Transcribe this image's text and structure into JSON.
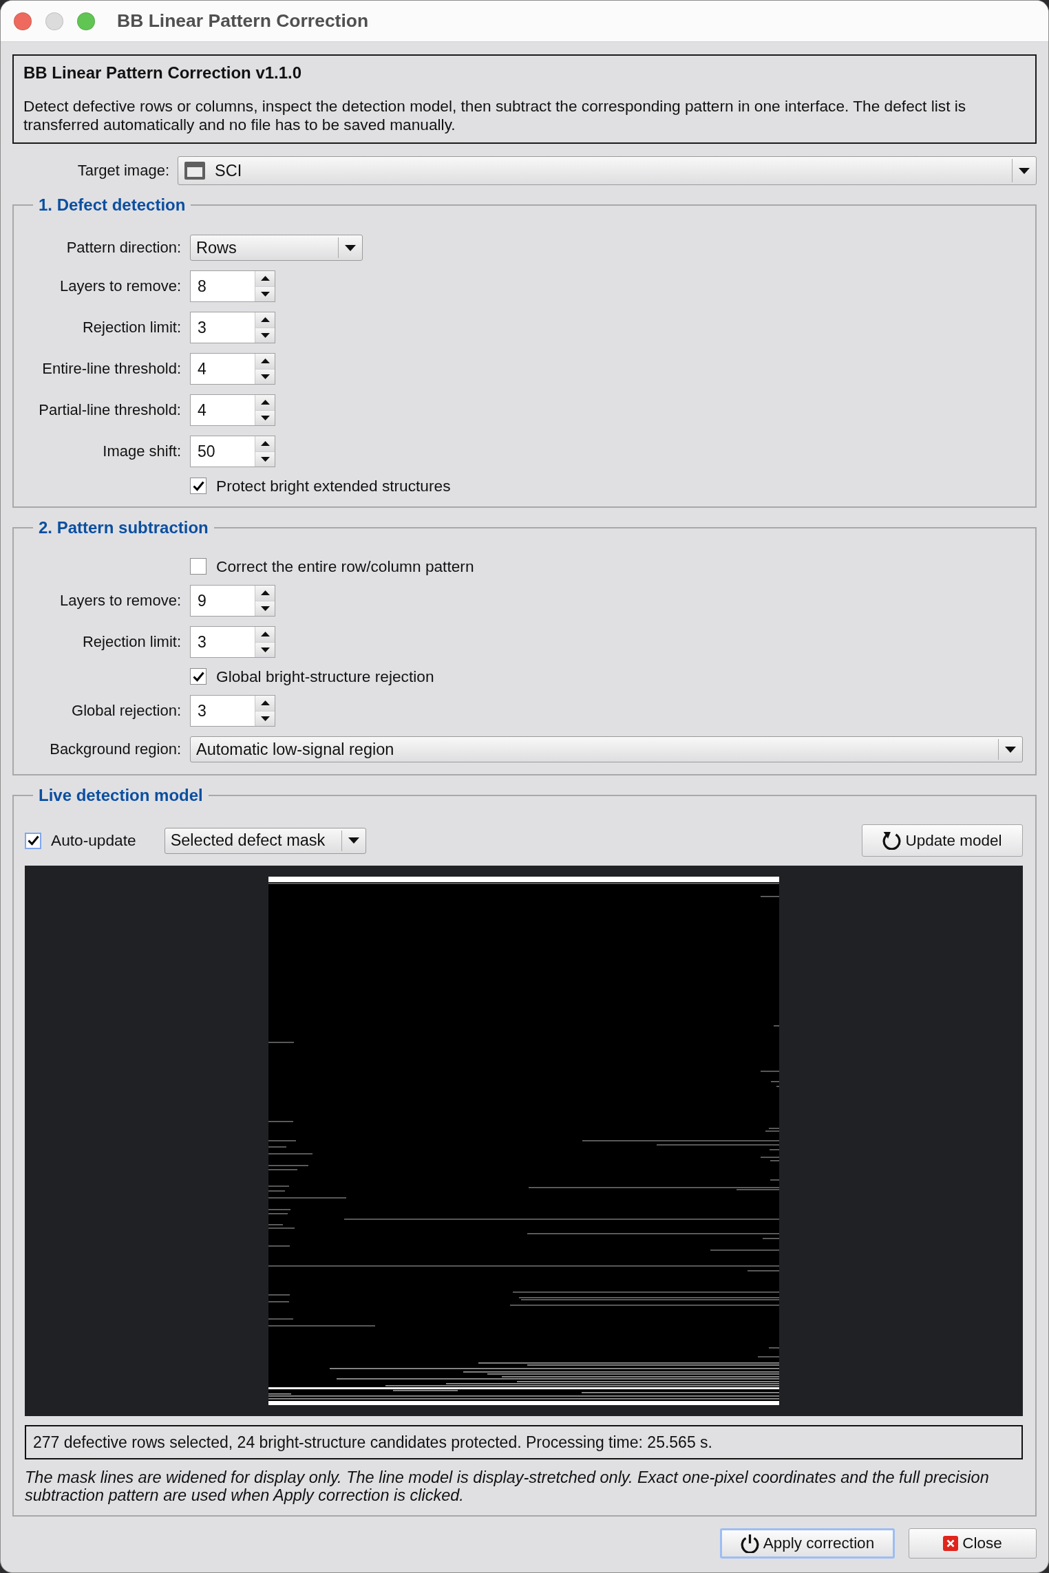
{
  "window": {
    "title": "BB Linear Pattern Correction",
    "controls": [
      {
        "kind": "close",
        "disabled": false
      },
      {
        "kind": "minimize",
        "disabled": true
      },
      {
        "kind": "zoom",
        "disabled": false
      }
    ]
  },
  "header": {
    "title": "BB Linear Pattern Correction v1.1.0",
    "description": "Detect defective rows or columns, inspect the detection model, then subtract the corresponding pattern in one interface. The defect list is transferred automatically and no file has to be saved manually."
  },
  "target_image": {
    "label": "Target image:",
    "value": "SCI"
  },
  "defect_detection": {
    "title": "1. Defect detection",
    "fields": [
      {
        "kind": "combo",
        "label": "Pattern direction:",
        "value": "Rows"
      },
      {
        "kind": "spin",
        "label": "Layers to remove:",
        "value": "8"
      },
      {
        "kind": "spin",
        "label": "Rejection limit:",
        "value": "3"
      },
      {
        "kind": "spin",
        "label": "Entire-line threshold:",
        "value": "4"
      },
      {
        "kind": "spin",
        "label": "Partial-line threshold:",
        "value": "4"
      },
      {
        "kind": "spin",
        "label": "Image shift:",
        "value": "50"
      },
      {
        "kind": "check",
        "label": "Protect bright extended structures",
        "checked": true
      }
    ]
  },
  "pattern_subtraction": {
    "title": "2. Pattern subtraction",
    "fields": [
      {
        "kind": "check",
        "label": "Correct the entire row/column pattern",
        "checked": false
      },
      {
        "kind": "spin",
        "label": "Layers to remove:",
        "value": "9"
      },
      {
        "kind": "spin",
        "label": "Rejection limit:",
        "value": "3"
      },
      {
        "kind": "check",
        "label": "Global bright-structure rejection",
        "checked": true
      },
      {
        "kind": "spin",
        "label": "Global rejection:",
        "value": "3"
      },
      {
        "kind": "widecombo",
        "label": "Background region:",
        "value": "Automatic low-signal region"
      }
    ]
  },
  "live_detection_model": {
    "title": "Live detection model",
    "auto_update": {
      "label": "Auto-update",
      "checked": true,
      "focused": true
    },
    "display_mode": {
      "value": "Selected defect mask"
    },
    "update_button": {
      "kind": "refresh",
      "label": "Update model"
    },
    "status": "277 defective rows selected, 24 bright-structure candidates protected. Processing time: 25.565 s.",
    "note": "The mask lines are widened for display only. The line model is display-stretched only. Exact one-pixel coordinates and the full precision subtraction pattern are used when Apply correction is clicked."
  },
  "buttons": [
    {
      "kind": "apply",
      "label": "Apply correction",
      "default": true
    },
    {
      "kind": "close",
      "label": "Close",
      "default": false
    }
  ]
}
